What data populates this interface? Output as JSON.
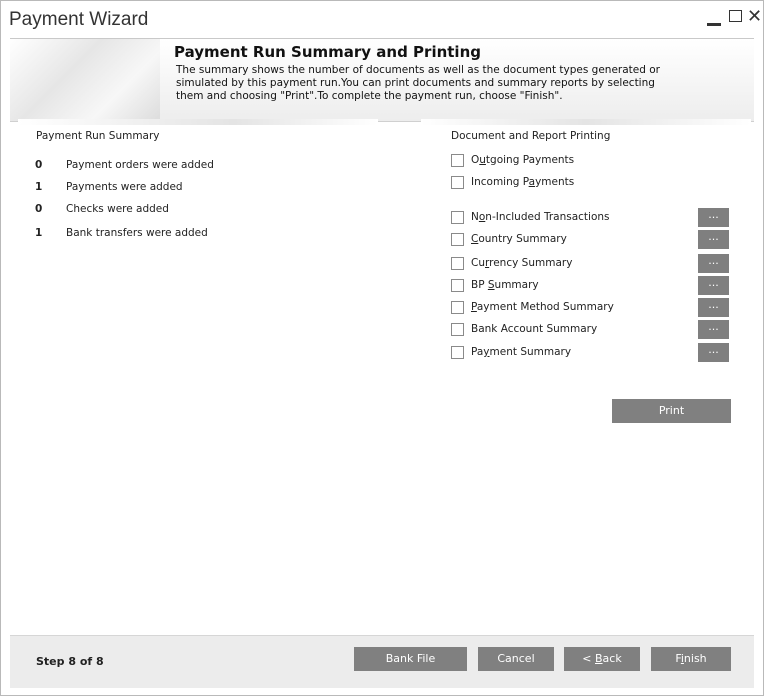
{
  "window": {
    "title": "Payment Wizard",
    "minimize_icon": "minimize-icon",
    "maximize_icon": "maximize-icon",
    "close_glyph": "✕"
  },
  "header": {
    "title": "Payment Run Summary and Printing",
    "description_lines": [
      "The summary shows the number of documents as well as the document types generated or",
      "simulated by this payment run.You can print documents and summary reports by selecting",
      "them and choosing \"Print\".To complete the payment run, choose \"Finish\"."
    ]
  },
  "summary": {
    "label": "Payment Run Summary",
    "rows": [
      {
        "count": "0",
        "text": "Payment orders were added"
      },
      {
        "count": "1",
        "text": "Payments were added"
      },
      {
        "count": "0",
        "text": "Checks were added"
      },
      {
        "count": "1",
        "text": "Bank transfers were added"
      }
    ]
  },
  "printing": {
    "label": "Document and Report Printing",
    "documents": [
      {
        "pre": "O",
        "u": "u",
        "post": "tgoing Payments"
      },
      {
        "pre": "Incoming P",
        "u": "a",
        "post": "yments"
      }
    ],
    "reports": [
      {
        "pre": "N",
        "u": "o",
        "post": "n-Included Transactions"
      },
      {
        "pre": "",
        "u": "C",
        "post": "ountry Summary"
      },
      {
        "pre": "Cu",
        "u": "r",
        "post": "rency Summary"
      },
      {
        "pre": "BP ",
        "u": "S",
        "post": "ummary"
      },
      {
        "pre": "",
        "u": "P",
        "post": "ayment Method Summary"
      },
      {
        "pre": "Bank Account Summary",
        "u": "",
        "post": ""
      },
      {
        "pre": "Pa",
        "u": "y",
        "post": "ment Summary"
      }
    ],
    "dots_label": "...",
    "print_label": "Print"
  },
  "footer": {
    "step": "Step 8 of 8",
    "bank_file": "Bank File",
    "cancel": "Cancel",
    "back_pre": "< ",
    "back_u": "B",
    "back_post": "ack",
    "finish_pre": "F",
    "finish_u": "i",
    "finish_post": "nish"
  }
}
